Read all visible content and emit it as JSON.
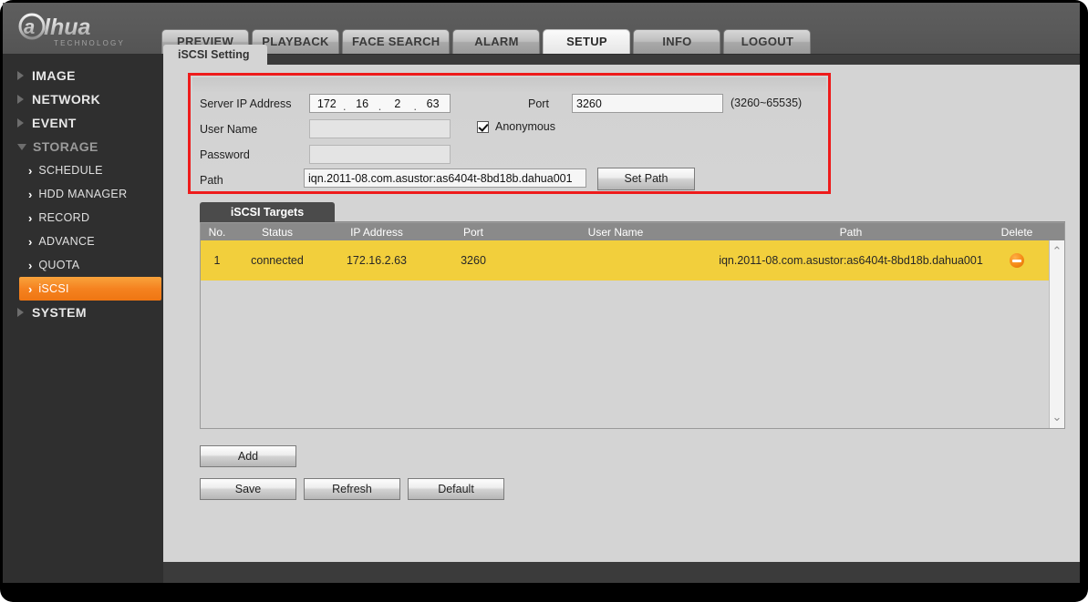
{
  "brand": {
    "name": "alhua",
    "tagline": "TECHNOLOGY"
  },
  "nav": {
    "tabs": [
      {
        "label": "PREVIEW",
        "active": false
      },
      {
        "label": "PLAYBACK",
        "active": false
      },
      {
        "label": "FACE SEARCH",
        "active": false
      },
      {
        "label": "ALARM",
        "active": false
      },
      {
        "label": "SETUP",
        "active": true
      },
      {
        "label": "INFO",
        "active": false
      },
      {
        "label": "LOGOUT",
        "active": false
      }
    ]
  },
  "sidebar": {
    "items": [
      {
        "label": "IMAGE",
        "expanded": false
      },
      {
        "label": "NETWORK",
        "expanded": false
      },
      {
        "label": "EVENT",
        "expanded": false
      },
      {
        "label": "STORAGE",
        "expanded": true
      },
      {
        "label": "SYSTEM",
        "expanded": false
      }
    ],
    "storage_children": [
      {
        "label": "SCHEDULE",
        "selected": false
      },
      {
        "label": "HDD MANAGER",
        "selected": false
      },
      {
        "label": "RECORD",
        "selected": false
      },
      {
        "label": "ADVANCE",
        "selected": false
      },
      {
        "label": "QUOTA",
        "selected": false
      },
      {
        "label": "iSCSI",
        "selected": true
      }
    ],
    "chevron": "›",
    "selected_color": "#f58220"
  },
  "page": {
    "tab_label": "iSCSI Setting",
    "highlight_color": "#ee1b1b"
  },
  "form": {
    "server_ip_label": "Server IP Address",
    "server_ip": {
      "o1": "172",
      "o2": "16",
      "o3": "2",
      "o4": "63",
      "sep": "."
    },
    "port_label": "Port",
    "port_value": "3260",
    "port_range_hint": "(3260~65535)",
    "user_name_label": "User Name",
    "user_name_value": "",
    "user_name_placeholder": "",
    "password_label": "Password",
    "password_value": "",
    "password_placeholder": "",
    "anonymous_label": "Anonymous",
    "anonymous_checked": true,
    "path_label": "Path",
    "path_value": "iqn.2011-08.com.asustor:as6404t-8bd18b.dahua001",
    "set_path_label": "Set Path"
  },
  "targets": {
    "tab_label": "iSCSI Targets",
    "columns": [
      "No.",
      "Status",
      "IP Address",
      "Port",
      "User Name",
      "Path",
      "Delete"
    ],
    "rows": [
      {
        "no": "1",
        "status": "connected",
        "ip": "172.16.2.63",
        "port": "3260",
        "user": "",
        "path": "iqn.2011-08.com.asustor:as6404t-8bd18b.dahua001",
        "delete_icon": "delete-circle-icon"
      }
    ],
    "row_color": "#f2cf3c",
    "scroll_up_icon": "⌃",
    "scroll_down_icon": "⌄"
  },
  "actions": {
    "add": "Add",
    "save": "Save",
    "refresh": "Refresh",
    "default": "Default"
  }
}
